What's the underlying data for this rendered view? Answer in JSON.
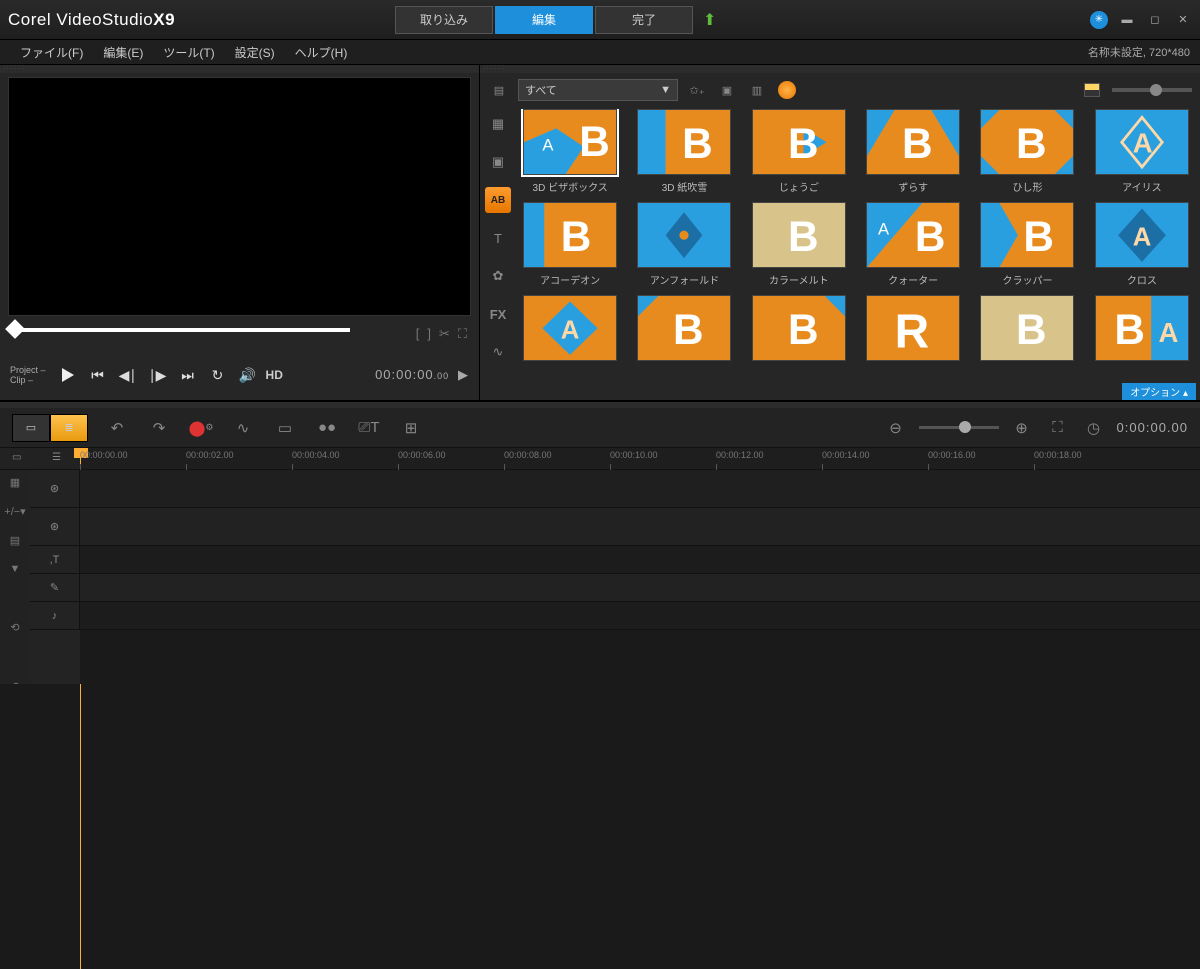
{
  "titlebar": {
    "brand_corel": "Corel",
    "brand_video": "Video",
    "brand_studio": "Studio",
    "brand_version": "X9"
  },
  "steps": {
    "capture": "取り込み",
    "edit": "編集",
    "share": "完了"
  },
  "menubar": {
    "file": "ファイル(F)",
    "edit": "編集(E)",
    "tools": "ツール(T)",
    "settings": "設定(S)",
    "help": "ヘルプ(H)"
  },
  "project": {
    "info": "名称未設定, 720*480"
  },
  "preview": {
    "mode_project": "Project –",
    "mode_clip": "Clip –",
    "hd_label": "HD",
    "timecode_main": "00:00:00",
    "timecode_sub": ".00",
    "arrow": "▶"
  },
  "library": {
    "category": "すべて",
    "options_label": "オプション ▴",
    "side_media": "▦",
    "side_video": "▣",
    "side_ab": "AB",
    "side_title": "T",
    "side_graph": "✿",
    "side_fx": "FX",
    "side_path": "∿"
  },
  "thumbs": [
    {
      "label": "3D ビザボックス"
    },
    {
      "label": "3D 紙吹雪"
    },
    {
      "label": "じょうご"
    },
    {
      "label": "ずらす"
    },
    {
      "label": "ひし形"
    },
    {
      "label": "アイリス"
    },
    {
      "label": "アコーデオン"
    },
    {
      "label": "アンフォールド"
    },
    {
      "label": "カラーメルト"
    },
    {
      "label": "クォーター"
    },
    {
      "label": "クラッパー"
    },
    {
      "label": "クロス"
    },
    {
      "label": ""
    },
    {
      "label": ""
    },
    {
      "label": ""
    },
    {
      "label": ""
    },
    {
      "label": ""
    },
    {
      "label": ""
    }
  ],
  "ruler": {
    "marks": [
      "00:00:00.00",
      "00:00:02.00",
      "00:00:04.00",
      "00:00:06.00",
      "00:00:08.00",
      "00:00:10.00",
      "00:00:12.00",
      "00:00:14.00",
      "00:00:16.00",
      "00:00:18.00"
    ]
  },
  "timeline": {
    "timecode_main": "0:00:00",
    "timecode_sub": ".00",
    "plus_minus": "+/−▾"
  }
}
